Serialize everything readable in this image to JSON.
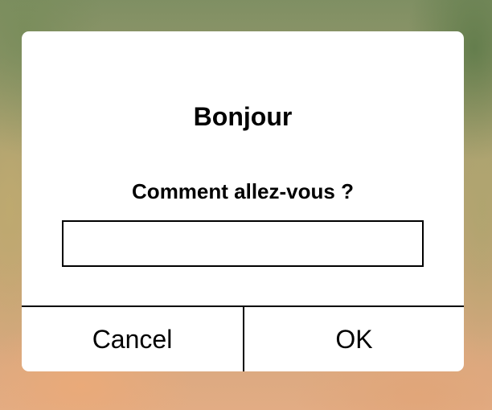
{
  "dialog": {
    "title": "Bonjour",
    "message": "Comment allez-vous ?",
    "input": {
      "value": "",
      "placeholder": ""
    },
    "buttons": {
      "cancel_label": "Cancel",
      "ok_label": "OK"
    }
  },
  "colors": {
    "dialog_background": "#ffffff",
    "text": "#000000",
    "divider": "#000000"
  }
}
